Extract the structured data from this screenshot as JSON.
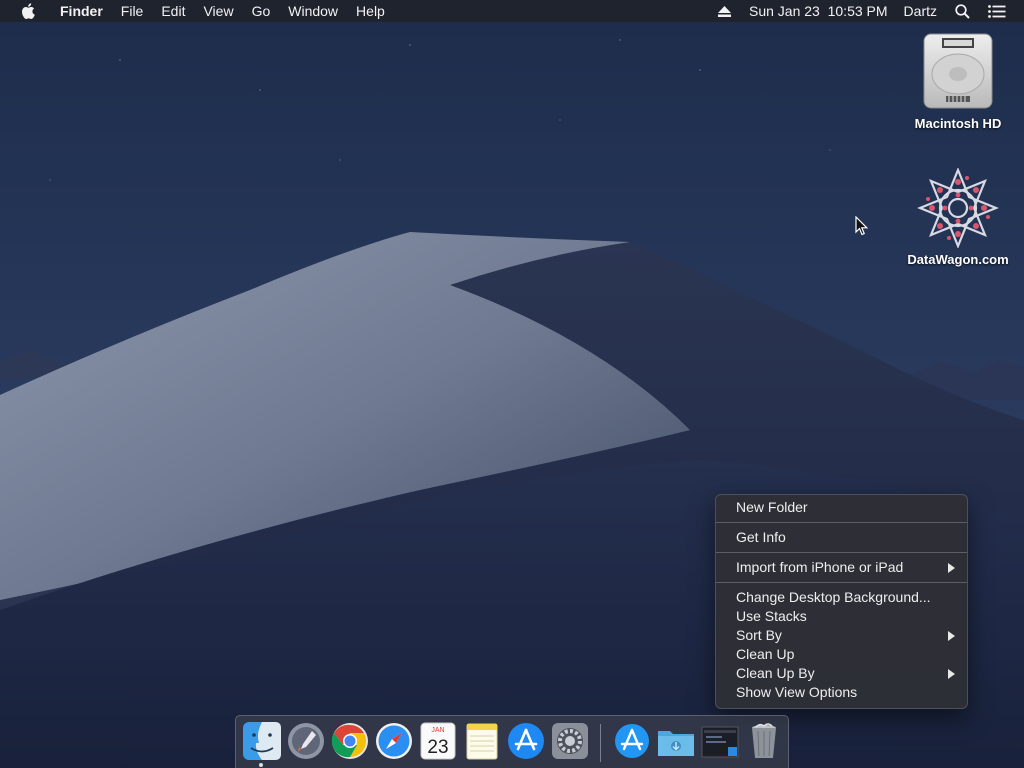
{
  "menubar": {
    "apple_icon": "apple-icon",
    "app_name": "Finder",
    "menus": [
      "File",
      "Edit",
      "View",
      "Go",
      "Window",
      "Help"
    ],
    "status": {
      "eject_icon": "eject-icon",
      "datetime": "Sun Jan 23  10:53 PM",
      "user": "Dartz",
      "spotlight_icon": "spotlight-search-icon",
      "notifications_icon": "notification-center-icon"
    }
  },
  "desktop": {
    "icons": [
      {
        "label": "Macintosh HD",
        "icon": "hard-drive-icon"
      },
      {
        "label": "DataWagon.com",
        "icon": "mandala-disk-icon"
      }
    ]
  },
  "context_menu": {
    "groups": [
      [
        {
          "label": "New Folder",
          "submenu": false
        }
      ],
      [
        {
          "label": "Get Info",
          "submenu": false
        }
      ],
      [
        {
          "label": "Import from iPhone or iPad",
          "submenu": true
        }
      ],
      [
        {
          "label": "Change Desktop Background...",
          "submenu": false
        },
        {
          "label": "Use Stacks",
          "submenu": false
        },
        {
          "label": "Sort By",
          "submenu": true
        },
        {
          "label": "Clean Up",
          "submenu": false
        },
        {
          "label": "Clean Up By",
          "submenu": true
        },
        {
          "label": "Show View Options",
          "submenu": false
        }
      ]
    ]
  },
  "dock": {
    "apps": [
      {
        "name": "finder-icon",
        "running": true
      },
      {
        "name": "launchpad-icon",
        "running": false
      },
      {
        "name": "chrome-icon",
        "running": false
      },
      {
        "name": "safari-icon",
        "running": false
      },
      {
        "name": "calendar-icon",
        "running": false,
        "month": "JAN",
        "day": "23"
      },
      {
        "name": "notes-icon",
        "running": false
      },
      {
        "name": "app-store-icon",
        "running": false
      },
      {
        "name": "system-preferences-icon",
        "running": false
      },
      {
        "name": "applications-folder-icon",
        "running": false
      },
      {
        "name": "downloads-folder-icon",
        "running": false
      },
      {
        "name": "screen-recording-icon",
        "running": false
      },
      {
        "name": "trash-icon",
        "running": false
      }
    ]
  }
}
